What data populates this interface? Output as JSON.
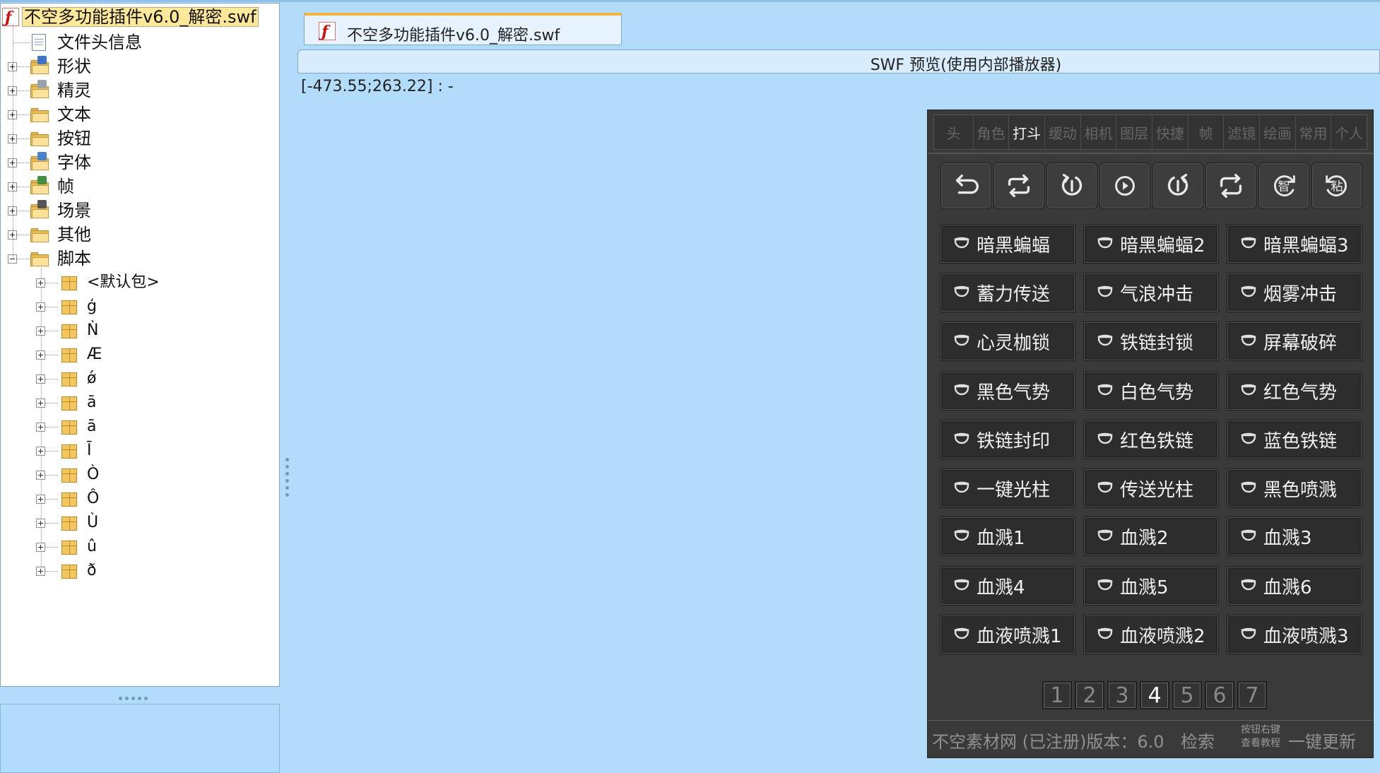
{
  "root": {
    "label": "不空多功能插件v6.0_解密.swf"
  },
  "tree": {
    "nodes": [
      {
        "label": "文件头信息",
        "icon": "document-icon"
      },
      {
        "label": "形状",
        "icon": "shapes-folder-icon"
      },
      {
        "label": "精灵",
        "icon": "sprites-folder-icon"
      },
      {
        "label": "文本",
        "icon": "texts-folder-icon"
      },
      {
        "label": "按钮",
        "icon": "buttons-folder-icon"
      },
      {
        "label": "字体",
        "icon": "fonts-folder-icon"
      },
      {
        "label": "帧",
        "icon": "frames-folder-icon"
      },
      {
        "label": "场景",
        "icon": "scenes-folder-icon"
      },
      {
        "label": "其他",
        "icon": "others-folder-icon"
      },
      {
        "label": "脚本",
        "icon": "scripts-folder-icon"
      }
    ],
    "packages": [
      "<默认包>",
      "ģ",
      "Ǹ",
      "Æ",
      "ǿ",
      "ā",
      "ā",
      "Ī",
      "Ò",
      "Ô",
      "Ù",
      "û",
      "ð"
    ]
  },
  "tab": {
    "label": "不空多功能插件v6.0_解密.swf"
  },
  "preview": {
    "title": "SWF 预览(使用内部播放器)",
    "coords": "[-473.55;263.22] : -"
  },
  "plugin": {
    "tabs": [
      "头",
      "角色",
      "打斗",
      "缓动",
      "相机",
      "图层",
      "快捷",
      "帧",
      "滤镜",
      "绘画",
      "常用",
      "个人"
    ],
    "active_tab": "打斗",
    "tools": [
      "undo-icon",
      "loop-icon",
      "loop-play-icon",
      "play-icon",
      "reverse-loop-icon",
      "repeat-icon",
      "smart-icon",
      "paste-icon"
    ],
    "tool_glyphs": {
      "smart": "智",
      "paste": "粘"
    },
    "buttons": [
      "暗黑蝙蝠",
      "暗黑蝙蝠2",
      "暗黑蝙蝠3",
      "蓄力传送",
      "气浪冲击",
      "烟雾冲击",
      "心灵枷锁",
      "铁链封锁",
      "屏幕破碎",
      "黑色气势",
      "白色气势",
      "红色气势",
      "铁链封印",
      "红色铁链",
      "蓝色铁链",
      "一键光柱",
      "传送光柱",
      "黑色喷溅",
      "血溅1",
      "血溅2",
      "血溅3",
      "血溅4",
      "血溅5",
      "血溅6",
      "血液喷溅1",
      "血液喷溅2",
      "血液喷溅3"
    ],
    "pages": [
      "1",
      "2",
      "3",
      "4",
      "5",
      "6",
      "7"
    ],
    "active_page": "4",
    "footer": {
      "site": "不空素材网 (已注册)版本：6.0",
      "search": "检索",
      "hint_line1": "按钮右键",
      "hint_line2": "查看教程",
      "update": "一键更新"
    }
  },
  "colors": {
    "background": "#b3dcfb",
    "panel": "#3a3a3a",
    "accent": "#f5b53c"
  }
}
